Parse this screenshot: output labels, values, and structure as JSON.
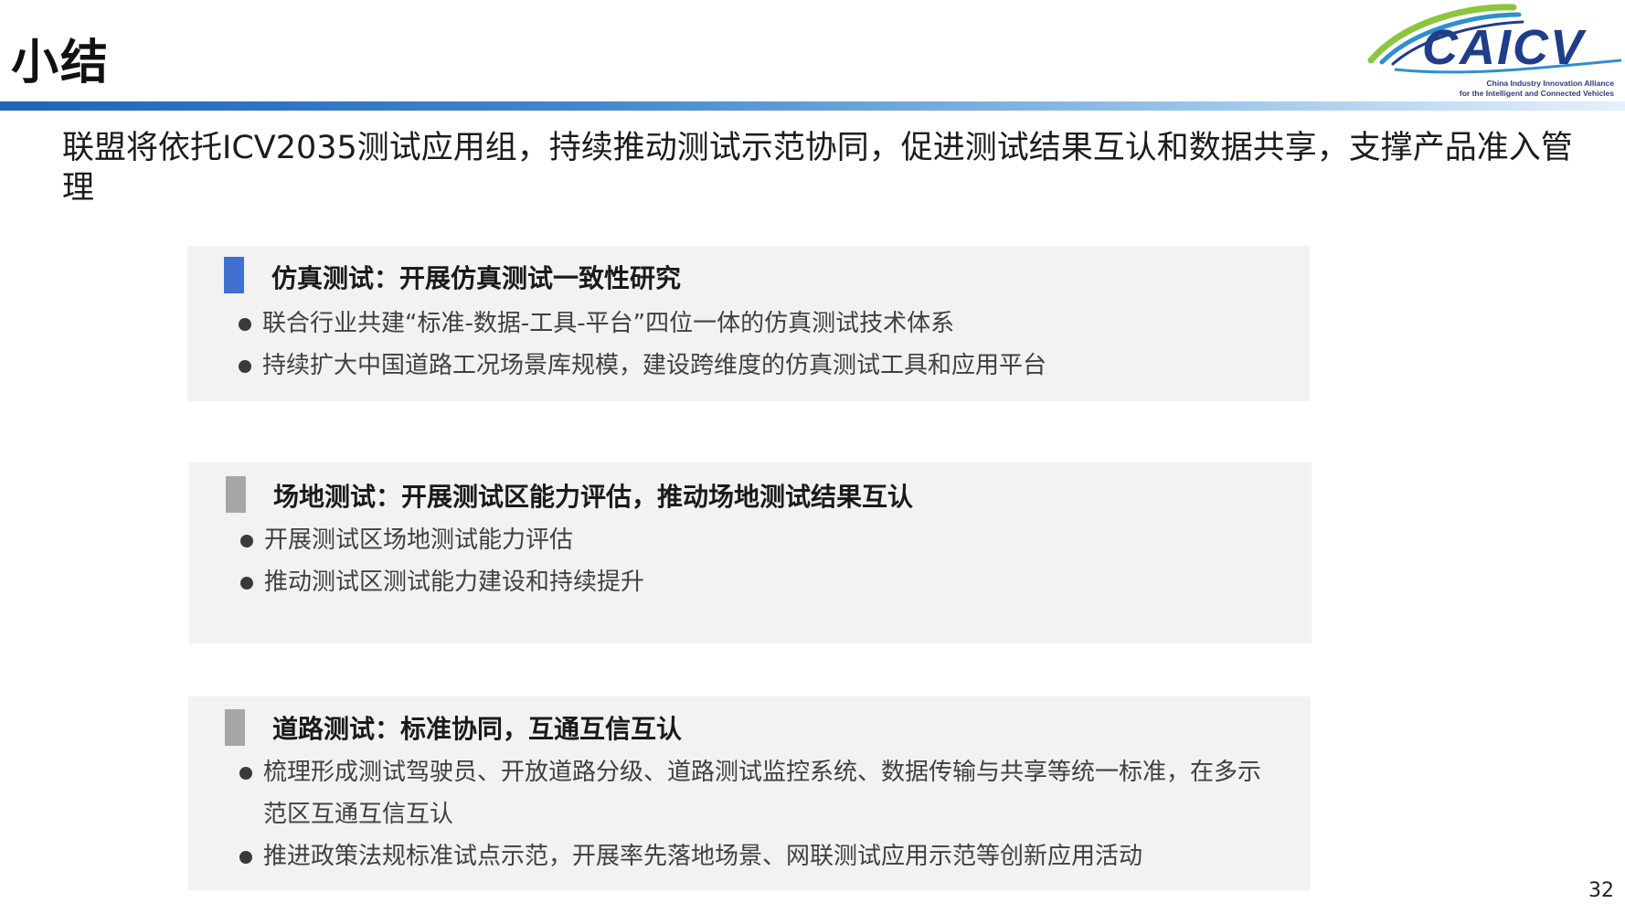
{
  "header": {
    "title": "小结",
    "logo": {
      "name": "CAICV",
      "line1": "China Industry Innovation Alliance",
      "line2": "for the Intelligent and Connected Vehicles",
      "colors": {
        "primary": "#1f3e8a",
        "accent": "#8cc63f",
        "swoosh": "#2f8fd0"
      }
    },
    "bar_color": "#1f66b8"
  },
  "intro": "联盟将依托ICV2035测试应用组，持续推动测试示范协同，促进测试结果互认和数据共享，支撑产品准入管理",
  "sections": [
    {
      "title": "仿真测试：开展仿真测试一致性研究",
      "marker_color": "#3f6fcf",
      "bullets": [
        "联合行业共建“标准-数据-工具-平台”四位一体的仿真测试技术体系",
        "持续扩大中国道路工况场景库规模，建设跨维度的仿真测试工具和应用平台"
      ]
    },
    {
      "title": "场地测试：开展测试区能力评估，推动场地测试结果互认",
      "marker_color": "#a6a6a6",
      "bullets": [
        "开展测试区场地测试能力评估",
        "推动测试区测试能力建设和持续提升"
      ]
    },
    {
      "title": "道路测试：标准协同，互通互信互认",
      "marker_color": "#a6a6a6",
      "bullets": [
        "梳理形成测试驾驶员、开放道路分级、道路测试监控系统、数据传输与共享等统一标准，在多示范区互通互信互认",
        "推进政策法规标准试点示范，开展率先落地场景、网联测试应用示范等创新应用活动"
      ]
    }
  ],
  "page_number": "32"
}
